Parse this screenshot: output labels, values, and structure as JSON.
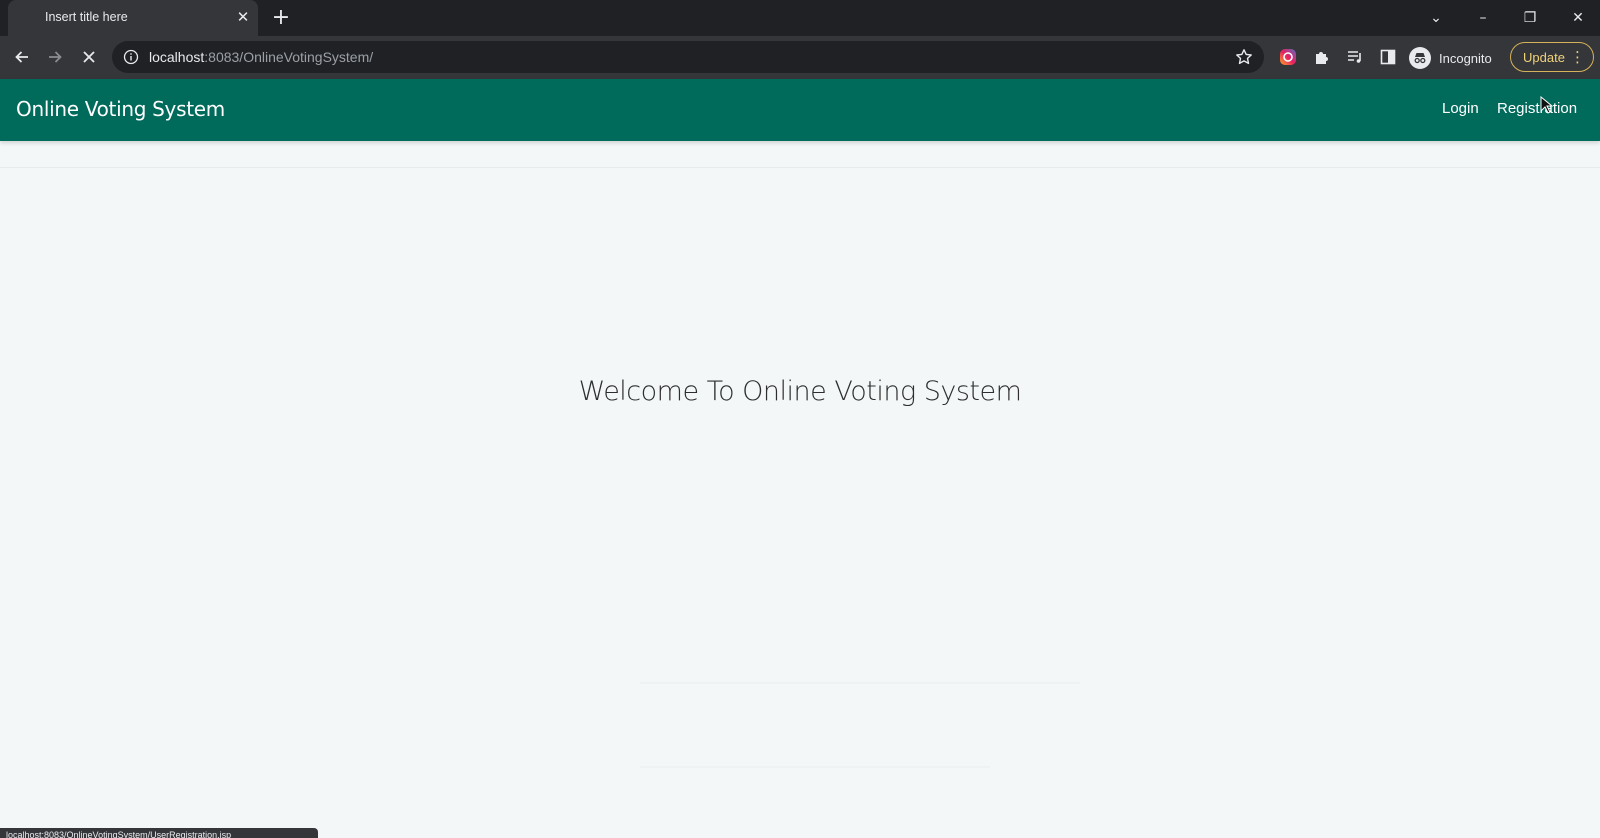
{
  "browser": {
    "tab_title": "Insert title here",
    "url_host": "localhost",
    "url_rest": ":8083/OnlineVotingSystem/",
    "profile_label": "Incognito",
    "update_label": "Update",
    "status_url": "localhost:8083/OnlineVotingSystem/UserRegistration.jsp"
  },
  "app": {
    "brand": "Online Voting System",
    "nav": {
      "login": "Login",
      "registration": "Registration"
    },
    "welcome": "Welcome To Online Voting System",
    "brand_color": "#006a5b"
  },
  "icons": {
    "back": "arrow-left-icon",
    "forward": "arrow-right-icon",
    "stop": "close-icon",
    "info": "info-icon",
    "star": "star-icon",
    "extensions": "puzzle-icon"
  }
}
